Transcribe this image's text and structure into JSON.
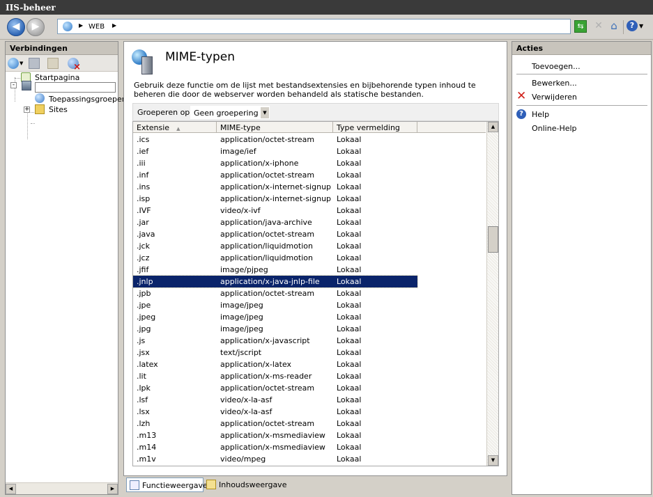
{
  "window": {
    "title": "IIS-beheer"
  },
  "address": {
    "crumbs": [
      "WEB"
    ]
  },
  "connections": {
    "title": "Verbindingen",
    "tree": {
      "start_page": "Startpagina",
      "server_name": "",
      "app_pools": "Toepassingsgroepen",
      "sites": "Sites"
    }
  },
  "feature": {
    "title": "MIME-typen",
    "description": "Gebruik deze functie om de lijst met bestandsextensies en bijbehorende typen inhoud te beheren die door de webserver worden behandeld als statische bestanden.",
    "group_label": "Groeperen op:",
    "group_value": "Geen groepering",
    "columns": [
      "Extensie",
      "MIME-type",
      "Type vermelding"
    ],
    "selected_index": 12,
    "rows": [
      [
        ".ics",
        "application/octet-stream",
        "Lokaal"
      ],
      [
        ".ief",
        "image/ief",
        "Lokaal"
      ],
      [
        ".iii",
        "application/x-iphone",
        "Lokaal"
      ],
      [
        ".inf",
        "application/octet-stream",
        "Lokaal"
      ],
      [
        ".ins",
        "application/x-internet-signup",
        "Lokaal"
      ],
      [
        ".isp",
        "application/x-internet-signup",
        "Lokaal"
      ],
      [
        ".IVF",
        "video/x-ivf",
        "Lokaal"
      ],
      [
        ".jar",
        "application/java-archive",
        "Lokaal"
      ],
      [
        ".java",
        "application/octet-stream",
        "Lokaal"
      ],
      [
        ".jck",
        "application/liquidmotion",
        "Lokaal"
      ],
      [
        ".jcz",
        "application/liquidmotion",
        "Lokaal"
      ],
      [
        ".jfif",
        "image/pjpeg",
        "Lokaal"
      ],
      [
        ".jnlp",
        "application/x-java-jnlp-file",
        "Lokaal"
      ],
      [
        ".jpb",
        "application/octet-stream",
        "Lokaal"
      ],
      [
        ".jpe",
        "image/jpeg",
        "Lokaal"
      ],
      [
        ".jpeg",
        "image/jpeg",
        "Lokaal"
      ],
      [
        ".jpg",
        "image/jpeg",
        "Lokaal"
      ],
      [
        ".js",
        "application/x-javascript",
        "Lokaal"
      ],
      [
        ".jsx",
        "text/jscript",
        "Lokaal"
      ],
      [
        ".latex",
        "application/x-latex",
        "Lokaal"
      ],
      [
        ".lit",
        "application/x-ms-reader",
        "Lokaal"
      ],
      [
        ".lpk",
        "application/octet-stream",
        "Lokaal"
      ],
      [
        ".lsf",
        "video/x-la-asf",
        "Lokaal"
      ],
      [
        ".lsx",
        "video/x-la-asf",
        "Lokaal"
      ],
      [
        ".lzh",
        "application/octet-stream",
        "Lokaal"
      ],
      [
        ".m13",
        "application/x-msmediaview",
        "Lokaal"
      ],
      [
        ".m14",
        "application/x-msmediaview",
        "Lokaal"
      ],
      [
        ".m1v",
        "video/mpeg",
        "Lokaal"
      ]
    ]
  },
  "views": {
    "features": "Functieweergave",
    "content": "Inhoudsweergave"
  },
  "actions": {
    "title": "Acties",
    "add": "Toevoegen...",
    "edit": "Bewerken...",
    "remove": "Verwijderen",
    "help": "Help",
    "online_help": "Online-Help"
  }
}
